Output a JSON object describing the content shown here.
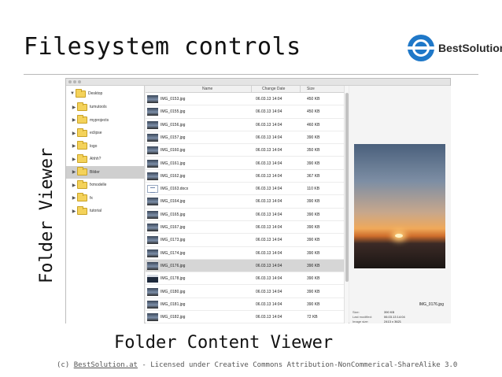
{
  "slide": {
    "title": "Filesystem controls",
    "vertical_label": "Folder Viewer",
    "caption": "Folder Content Viewer",
    "footer_prefix": "(c) ",
    "footer_link": "BestSolution.at",
    "footer_suffix": " - Licensed under Creative Commons Attribution-NonCommerical-ShareAlike 3.0",
    "logo_text": "BestSolution"
  },
  "tree": {
    "root": "Desktop",
    "items": [
      {
        "label": "tumutools",
        "selected": false
      },
      {
        "label": "myprojects",
        "selected": false
      },
      {
        "label": "eclipse",
        "selected": false
      },
      {
        "label": "logo",
        "selected": false
      },
      {
        "label": "Ahhh?",
        "selected": false
      },
      {
        "label": "Bilder",
        "selected": true
      },
      {
        "label": "fxmodelle",
        "selected": false
      },
      {
        "label": "fx",
        "selected": false
      },
      {
        "label": "tutorial",
        "selected": false
      }
    ]
  },
  "table": {
    "headers": {
      "name": "Name",
      "date": "Change Date",
      "size": "Size"
    },
    "rows": [
      {
        "name": "IMG_0153.jpg",
        "date": "06.03.13 14:04",
        "size": "450 KB",
        "thumb": "photo",
        "selected": false
      },
      {
        "name": "IMG_0155.jpg",
        "date": "06.03.13 14:04",
        "size": "450 KB",
        "thumb": "photo",
        "selected": false
      },
      {
        "name": "IMG_0156.jpg",
        "date": "06.03.13 14:04",
        "size": "460 KB",
        "thumb": "photo",
        "selected": false
      },
      {
        "name": "IMG_0157.jpg",
        "date": "06.03.13 14:04",
        "size": "390 KB",
        "thumb": "photo",
        "selected": false
      },
      {
        "name": "IMG_0160.jpg",
        "date": "06.03.13 14:04",
        "size": "350 KB",
        "thumb": "photo",
        "selected": false
      },
      {
        "name": "IMG_0161.jpg",
        "date": "06.03.13 14:04",
        "size": "390 KB",
        "thumb": "photo",
        "selected": false
      },
      {
        "name": "IMG_0162.jpg",
        "date": "06.03.13 14:04",
        "size": "367 KB",
        "thumb": "photo",
        "selected": false
      },
      {
        "name": "IMG_0163.docx",
        "date": "06.03.13 14:04",
        "size": "110 KB",
        "thumb": "doc",
        "selected": false
      },
      {
        "name": "IMG_0164.jpg",
        "date": "06.03.13 14:04",
        "size": "390 KB",
        "thumb": "photo",
        "selected": false
      },
      {
        "name": "IMG_0165.jpg",
        "date": "06.03.13 14:04",
        "size": "390 KB",
        "thumb": "photo",
        "selected": false
      },
      {
        "name": "IMG_0167.jpg",
        "date": "06.03.13 14:04",
        "size": "390 KB",
        "thumb": "photo",
        "selected": false
      },
      {
        "name": "IMG_0173.jpg",
        "date": "06.03.13 14:04",
        "size": "390 KB",
        "thumb": "photo",
        "selected": false
      },
      {
        "name": "IMG_0174.jpg",
        "date": "06.03.13 14:04",
        "size": "390 KB",
        "thumb": "photo",
        "selected": false
      },
      {
        "name": "IMG_0176.jpg",
        "date": "06.03.13 14:04",
        "size": "390 KB",
        "thumb": "photo",
        "selected": true
      },
      {
        "name": "IMG_0178.jpg",
        "date": "06.03.13 14:04",
        "size": "390 KB",
        "thumb": "person",
        "selected": false
      },
      {
        "name": "IMG_0180.jpg",
        "date": "06.03.13 14:04",
        "size": "390 KB",
        "thumb": "photo",
        "selected": false
      },
      {
        "name": "IMG_0181.jpg",
        "date": "06.03.13 14:04",
        "size": "390 KB",
        "thumb": "photo",
        "selected": false
      },
      {
        "name": "IMG_0182.jpg",
        "date": "06.03.13 14:04",
        "size": "72 KB",
        "thumb": "photo",
        "selected": false
      }
    ]
  },
  "preview": {
    "filename": "IMG_0176.jpg",
    "meta": [
      {
        "label": "Size:",
        "value": "390 KB"
      },
      {
        "label": "Last modified:",
        "value": "06.03.13 14:04"
      },
      {
        "label": "Image size:",
        "value": "2413 x 3621"
      }
    ]
  },
  "colors": {
    "accent": "#1f78c8",
    "folder": "#f4d25a",
    "selection": "#d6d6d6"
  },
  "icons": {
    "logo": "bestsolution-logo-icon",
    "folder": "folder-icon",
    "expand": "triangle-right-icon"
  }
}
